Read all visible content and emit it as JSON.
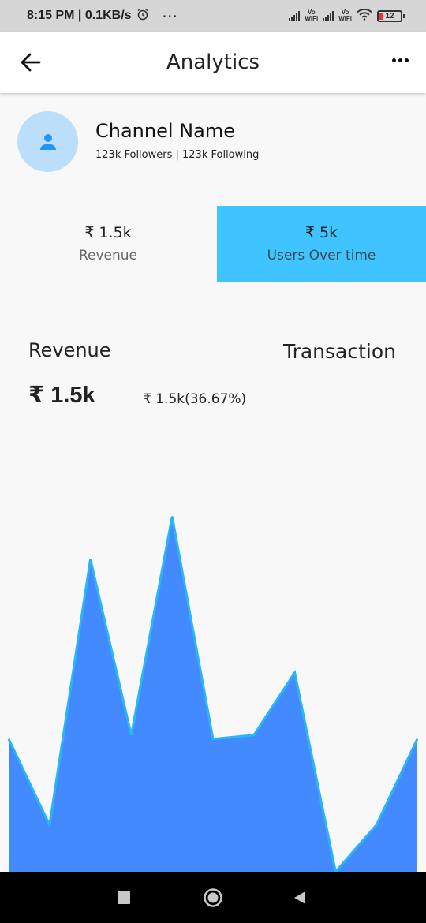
{
  "status_bar": {
    "time_speed": "8:15 PM | 0.1KB/s",
    "alarm_icon": "alarm-clock-icon",
    "more": "···",
    "vowifi_label_top": "Vo",
    "vowifi_label_bottom": "WiFi",
    "battery": "12"
  },
  "app_bar": {
    "title": "Analytics",
    "back_icon": "arrow-left-icon",
    "menu_icon": "more-horizontal-icon"
  },
  "channel": {
    "name": "Channel Name",
    "stats": "123k Followers | 123k Following",
    "avatar_icon": "person-icon"
  },
  "cards": {
    "revenue": {
      "value": "₹ 1.5k",
      "label": "Revenue"
    },
    "users": {
      "value": "₹ 5k",
      "label": "Users Over time"
    }
  },
  "sections": {
    "revenue_title": "Revenue",
    "transaction_title": "Transaction",
    "revenue_value": "₹ 1.5k",
    "revenue_change": "₹ 1.5k(36.67%)"
  },
  "colors": {
    "accent": "#40c4ff",
    "chart_fill": "#448aff",
    "chart_line": "#29b6f6",
    "avatar_bg": "#bbdefb",
    "avatar_icon": "#2196f3"
  },
  "chart_data": {
    "type": "area",
    "title": "",
    "xlabel": "",
    "ylabel": "",
    "x": [
      0,
      1,
      2,
      3,
      4,
      5,
      6,
      7,
      8,
      9,
      10
    ],
    "values": [
      34,
      12,
      80,
      35,
      91,
      34,
      35,
      51,
      0,
      12,
      34
    ],
    "ylim": [
      0,
      100
    ],
    "grid": false,
    "legend": "none"
  },
  "nav_bar": {
    "recents_icon": "square-icon",
    "home_icon": "circle-home-icon",
    "back_icon": "triangle-back-icon"
  }
}
